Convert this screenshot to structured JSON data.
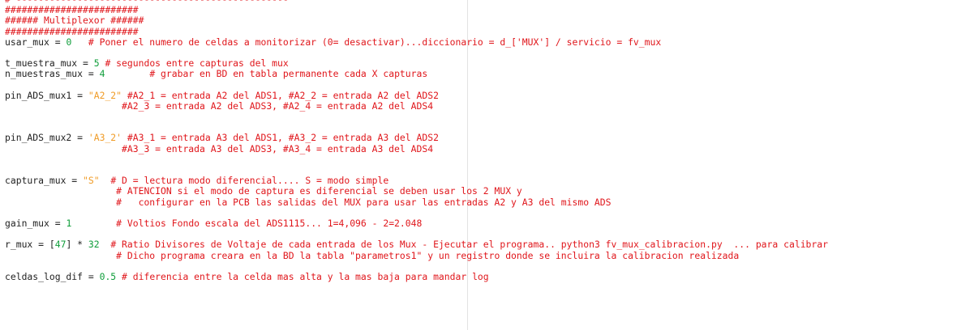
{
  "colors": {
    "comment": "#e0161b",
    "number": "#0f9d3a",
    "string": "#f09b25",
    "text": "#222222",
    "background": "#ffffff",
    "margin_line": "#e3e3e3"
  },
  "lines": [
    [
      {
        "t": "# -------------------------------------------------",
        "k": "c"
      }
    ],
    [
      {
        "t": "########################",
        "k": "c"
      }
    ],
    [
      {
        "t": "###### Multiplexor ######",
        "k": "c"
      }
    ],
    [
      {
        "t": "########################",
        "k": "c"
      }
    ],
    [
      {
        "t": "usar_mux = ",
        "k": "p"
      },
      {
        "t": "0",
        "k": "n"
      },
      {
        "t": "   ",
        "k": "p"
      },
      {
        "t": "# Poner el numero de celdas a monitorizar (0= desactivar)...diccionario = d_['MUX'] / servicio = fv_mux",
        "k": "c"
      }
    ],
    [],
    [
      {
        "t": "t_muestra_mux = ",
        "k": "p"
      },
      {
        "t": "5",
        "k": "n"
      },
      {
        "t": " ",
        "k": "p"
      },
      {
        "t": "# segundos entre capturas del mux",
        "k": "c"
      }
    ],
    [
      {
        "t": "n_muestras_mux = ",
        "k": "p"
      },
      {
        "t": "4",
        "k": "n"
      },
      {
        "t": "        ",
        "k": "p"
      },
      {
        "t": "# grabar en BD en tabla permanente cada X capturas",
        "k": "c"
      }
    ],
    [],
    [
      {
        "t": "pin_ADS_mux1 = ",
        "k": "p"
      },
      {
        "t": "\"A2_2\"",
        "k": "s"
      },
      {
        "t": " ",
        "k": "p"
      },
      {
        "t": "#A2_1 = entrada A2 del ADS1, #A2_2 = entrada A2 del ADS2",
        "k": "c"
      }
    ],
    [
      {
        "t": "                     ",
        "k": "p"
      },
      {
        "t": "#A2_3 = entrada A2 del ADS3, #A2_4 = entrada A2 del ADS4",
        "k": "c"
      }
    ],
    [],
    [],
    [
      {
        "t": "pin_ADS_mux2 = ",
        "k": "p"
      },
      {
        "t": "'A3_2'",
        "k": "s"
      },
      {
        "t": " ",
        "k": "p"
      },
      {
        "t": "#A3_1 = entrada A3 del ADS1, #A3_2 = entrada A3 del ADS2",
        "k": "c"
      }
    ],
    [
      {
        "t": "                     ",
        "k": "p"
      },
      {
        "t": "#A3_3 = entrada A3 del ADS3, #A3_4 = entrada A3 del ADS4",
        "k": "c"
      }
    ],
    [],
    [],
    [
      {
        "t": "captura_mux = ",
        "k": "p"
      },
      {
        "t": "\"S\"",
        "k": "s"
      },
      {
        "t": "  ",
        "k": "p"
      },
      {
        "t": "# D = lectura modo diferencial.... S = modo simple",
        "k": "c"
      }
    ],
    [
      {
        "t": "                    ",
        "k": "p"
      },
      {
        "t": "# ATENCION si el modo de captura es diferencial se deben usar los 2 MUX y",
        "k": "c"
      }
    ],
    [
      {
        "t": "                    ",
        "k": "p"
      },
      {
        "t": "#   configurar en la PCB las salidas del MUX para usar las entradas A2 y A3 del mismo ADS",
        "k": "c"
      }
    ],
    [],
    [
      {
        "t": "gain_mux = ",
        "k": "p"
      },
      {
        "t": "1",
        "k": "n"
      },
      {
        "t": "        ",
        "k": "p"
      },
      {
        "t": "# Voltios Fondo escala del ADS1115... 1=4,096 - 2=2.048",
        "k": "c"
      }
    ],
    [],
    [
      {
        "t": "r_mux = [",
        "k": "p"
      },
      {
        "t": "47",
        "k": "n"
      },
      {
        "t": "] * ",
        "k": "p"
      },
      {
        "t": "32",
        "k": "n"
      },
      {
        "t": "  ",
        "k": "p"
      },
      {
        "t": "# Ratio Divisores de Voltaje de cada entrada de los Mux - Ejecutar el programa.. python3 fv_mux_calibracion.py  ... para calibrar",
        "k": "c"
      }
    ],
    [
      {
        "t": "                    ",
        "k": "p"
      },
      {
        "t": "# Dicho programa creara en la BD la tabla \"parametros1\" y un registro donde se incluira la calibracion realizada",
        "k": "c"
      }
    ],
    [],
    [
      {
        "t": "celdas_log_dif = ",
        "k": "p"
      },
      {
        "t": "0.5",
        "k": "n"
      },
      {
        "t": " ",
        "k": "p"
      },
      {
        "t": "# diferencia entre la celda mas alta y la mas baja para mandar log",
        "k": "c"
      }
    ]
  ]
}
